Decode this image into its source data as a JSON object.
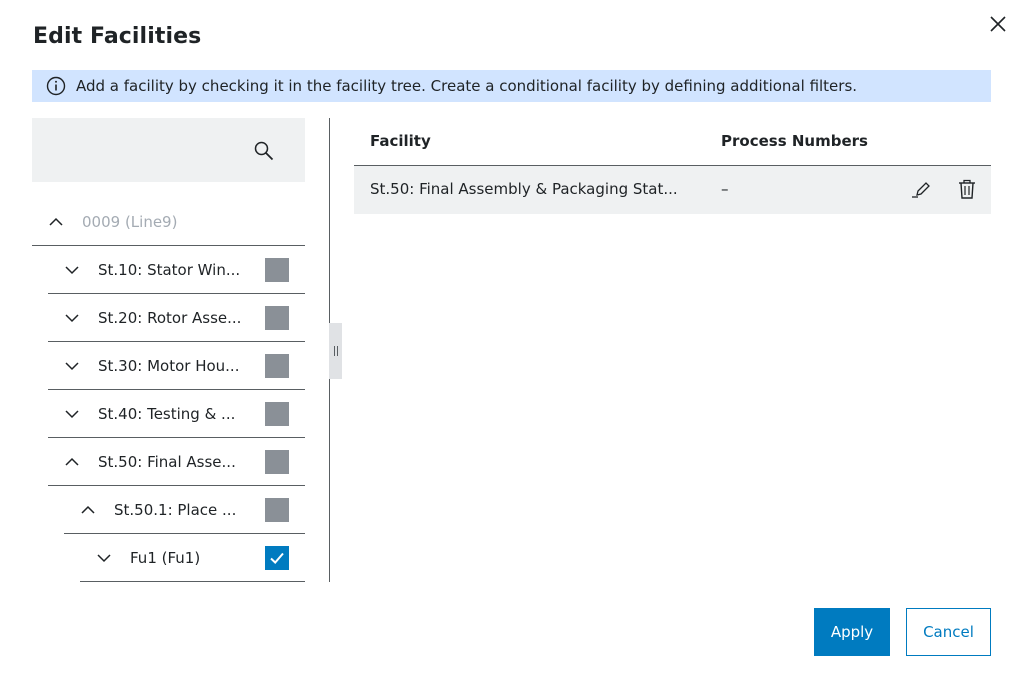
{
  "dialog": {
    "title": "Edit Facilities"
  },
  "info_banner": {
    "text": "Add a facility by checking it in the facility tree. Create a conditional facility by defining additional filters."
  },
  "tree": {
    "root": {
      "label": "0009 (Line9)",
      "expanded": true
    },
    "items": [
      {
        "label": "St.10: Stator Win...",
        "expanded": false,
        "checked": false
      },
      {
        "label": "St.20: Rotor Asse...",
        "expanded": false,
        "checked": false
      },
      {
        "label": "St.30: Motor Hou...",
        "expanded": false,
        "checked": false
      },
      {
        "label": "St.40: Testing & ...",
        "expanded": false,
        "checked": false
      },
      {
        "label": "St.50: Final Asse...",
        "expanded": true,
        "checked": false
      },
      {
        "label": "St.50.1: Place ...",
        "expanded": true,
        "checked": false
      },
      {
        "label": "Fu1 (Fu1)",
        "expanded": false,
        "checked": true
      }
    ]
  },
  "table": {
    "headers": {
      "facility": "Facility",
      "process_numbers": "Process Numbers"
    },
    "rows": [
      {
        "facility": "St.50: Final Assembly & Packaging Stat...",
        "process_numbers": "–"
      }
    ]
  },
  "footer": {
    "apply_label": "Apply",
    "cancel_label": "Cancel"
  },
  "colors": {
    "accent": "#007bc0",
    "info_banner_bg": "#d1e4ff",
    "checkbox_unchecked": "#8a9097",
    "panel_bg": "#eff1f2"
  }
}
